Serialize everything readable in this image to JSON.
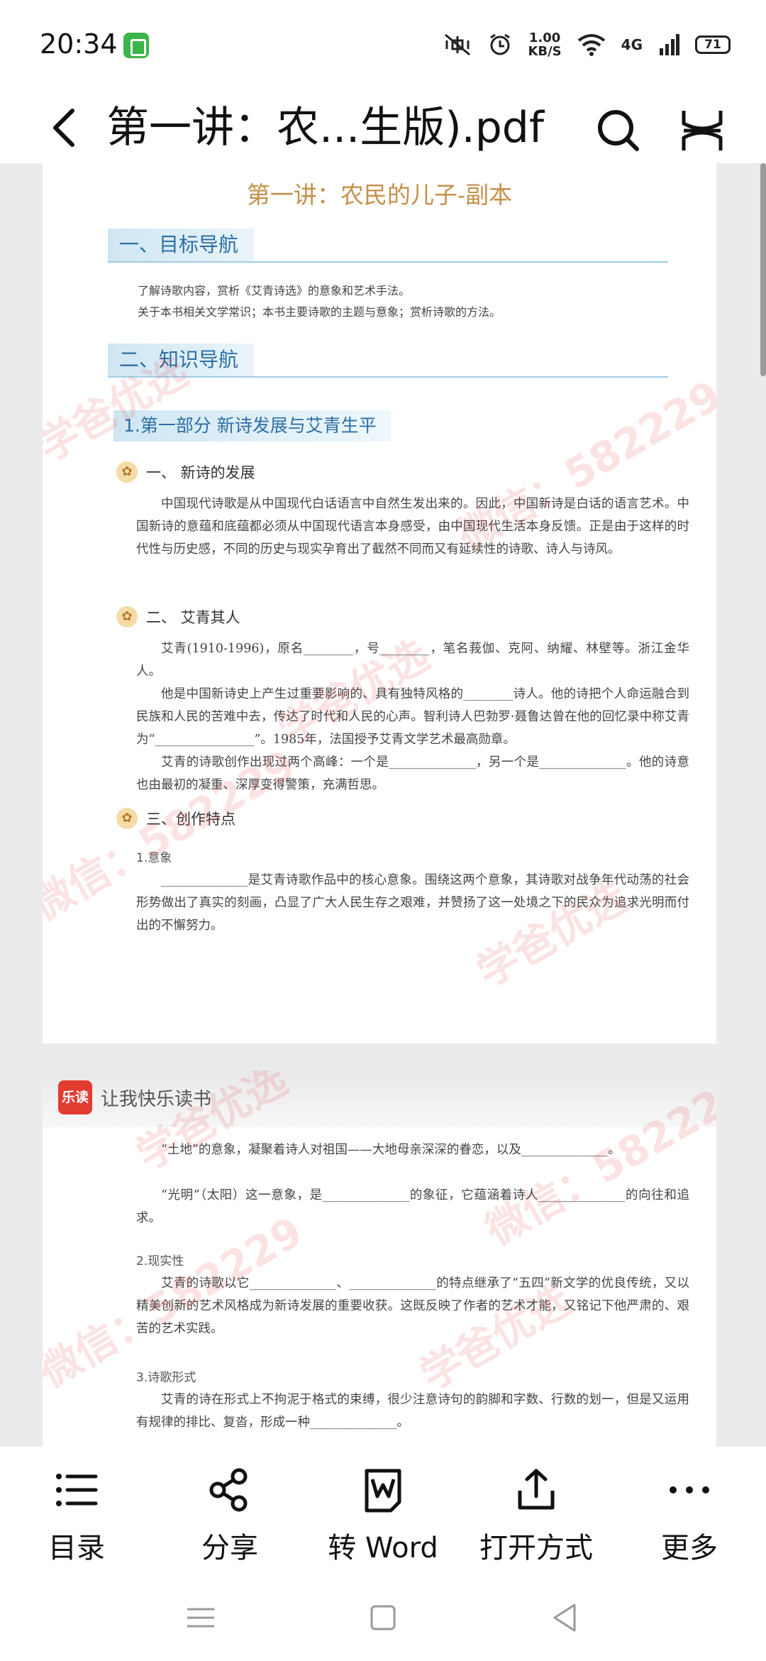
{
  "status_bar": {
    "time": "20:34",
    "net_speed_value": "1.00",
    "net_speed_unit": "KB/S",
    "network_type": "4G",
    "battery": "71"
  },
  "toolbar": {
    "title": "第一讲：农...生版).pdf"
  },
  "document": {
    "page1": {
      "title": "第一讲：农民的儿子-副本",
      "section1": "一、目标导航",
      "goal_line1": "了解诗歌内容，赏析《艾青诗选》的意象和艺术手法。",
      "goal_line2": "关于本书相关文学常识；本书主要诗歌的主题与意象；赏析诗歌的方法。",
      "section2": "二、知识导航",
      "part1": "1.第一部分  新诗发展与艾青生平",
      "sub1_title": "一、 新诗的发展",
      "sub1_text": "中国现代诗歌是从中国现代白话语言中自然生发出来的。因此，中国新诗是白话的语言艺术。中国新诗的意蕴和底蕴都必须从中国现代语言本身感受，由中国现代生活本身反馈。正是由于这样的时代性与历史感，不同的历史与现实孕育出了截然不同而又有延续性的诗歌、诗人与诗风。",
      "sub2_title": "二、 艾青其人",
      "sub2_p1": "艾青(1910-1996)，原名________，号________，笔名莪伽、克阿、纳耀、林壁等。浙江金华人。",
      "sub2_p2": "他是中国新诗史上产生过重要影响的、具有独特风格的________诗人。他的诗把个人命运融合到民族和人民的苦难中去，传达了时代和人民的心声。智利诗人巴勃罗·聂鲁达曾在他的回忆录中称艾青为“________________”。1985年，法国授予艾青文学艺术最高勋章。",
      "sub2_p3": "艾青的诗歌创作出现过两个高峰：一个是______________，另一个是______________。他的诗意也由最初的凝重、深厚变得警策，充满哲思。",
      "sub3_title": "三、创作特点",
      "label_imagery": "1.意象",
      "imagery_text": "______________是艾青诗歌作品中的核心意象。围绕这两个意象，其诗歌对战争年代动荡的社会形势做出了真实的刻画，凸显了广大人民生存之艰难，并赞扬了这一处境之下的民众为追求光明而付出的不懈努力。"
    },
    "page2": {
      "brand_logo": "乐读",
      "brand_slogan": "让我快乐读书",
      "p_land": "“土地”的意象，凝聚着诗人对祖国——大地母亲深深的眷恋，以及______________。",
      "p_sun": "“光明”（太阳）这一意象，是______________的象征，它蕴涵着诗人______________的向往和追求。",
      "label_reality": "2.现实性",
      "reality_text": "艾青的诗歌以它______________、______________的特点继承了“五四”新文学的优良传统，又以精美创新的艺术风格成为新诗发展的重要收获。这既反映了作者的艺术才能，又铭记下他严肃的、艰苦的艺术实践。",
      "label_form": "3.诗歌形式",
      "form_text": "艾青的诗在形式上不拘泥于格式的束缚，很少注意诗句的韵脚和字数、行数的划一，但是又运用有规律的排比、复沓，形成一种______________。"
    },
    "watermark_text": "学爸优选",
    "watermark_wechat": "微信：582229"
  },
  "bottom_bar": {
    "items": [
      {
        "label": "目录",
        "icon": "list-icon"
      },
      {
        "label": "分享",
        "icon": "share-icon"
      },
      {
        "label": "转 Word",
        "icon": "word-icon"
      },
      {
        "label": "打开方式",
        "icon": "open-with-icon"
      },
      {
        "label": "更多",
        "icon": "more-dots-icon"
      }
    ]
  },
  "colors": {
    "accent_title": "#c4904a",
    "section_blue": "#2d6fa6",
    "brand_red": "#e23b2f"
  }
}
